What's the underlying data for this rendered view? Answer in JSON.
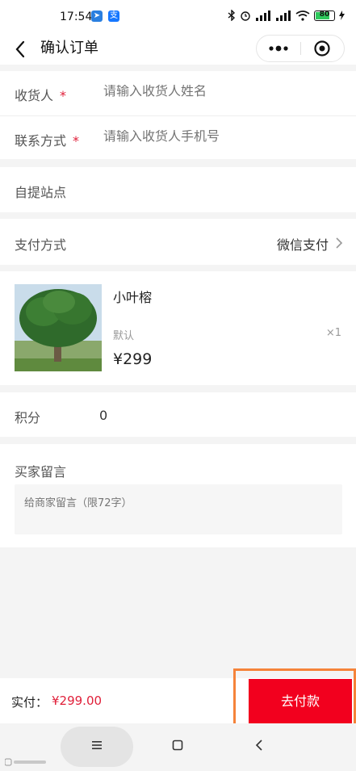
{
  "status": {
    "time": "17:54",
    "battery": "80",
    "battery_level": 0.8
  },
  "nav": {
    "title": "确认订单"
  },
  "form": {
    "receiver_label": "收货人",
    "receiver_placeholder": "请输入收货人姓名",
    "contact_label": "联系方式",
    "contact_placeholder": "请输入收货人手机号",
    "required_mark": "*"
  },
  "pickup": {
    "label": "自提站点"
  },
  "payment": {
    "label": "支付方式",
    "value": "微信支付"
  },
  "product": {
    "name": "小叶榕",
    "spec": "默认",
    "qty": "×1",
    "price": "¥299"
  },
  "points": {
    "label": "积分",
    "value": "0"
  },
  "message": {
    "label": "买家留言",
    "placeholder": "给商家留言（限72字）"
  },
  "bottom": {
    "total_label": "实付：",
    "total_value": "¥299.00",
    "pay_button": "去付款"
  },
  "colors": {
    "accent": "#f2001e",
    "highlight": "#f5833a",
    "required": "#e0203a"
  }
}
